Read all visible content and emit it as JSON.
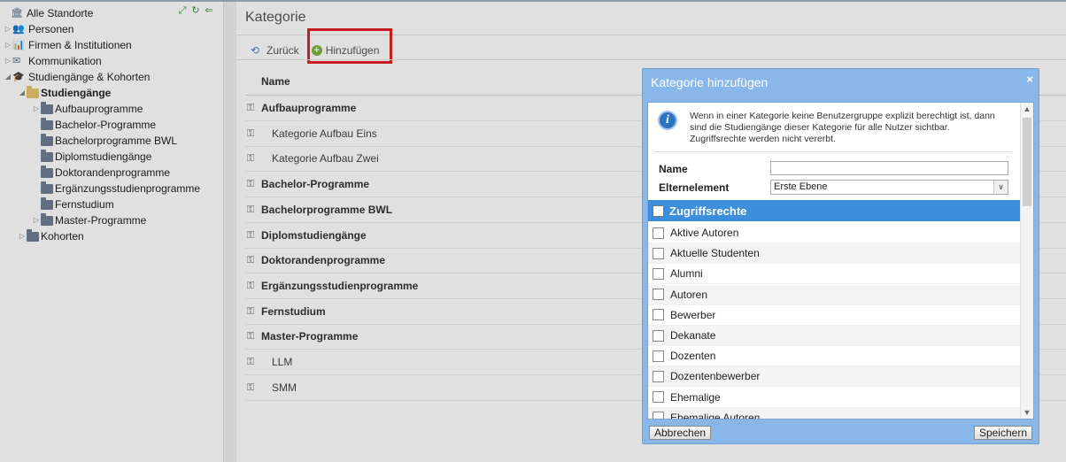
{
  "sidebar": {
    "items": [
      {
        "label": "Alle Standorte",
        "icon": "building-icon",
        "bold": false
      },
      {
        "label": "Personen",
        "icon": "people-icon",
        "bold": false
      },
      {
        "label": "Firmen & Institutionen",
        "icon": "chart-icon",
        "bold": false
      },
      {
        "label": "Kommunikation",
        "icon": "mail-icon",
        "bold": false
      },
      {
        "label": "Studiengänge & Kohorten",
        "icon": "grad-cap-icon",
        "bold": false
      },
      {
        "label": "Studiengänge",
        "icon": "folder-open-icon",
        "bold": true
      },
      {
        "label": "Aufbauprogramme",
        "icon": "folder-icon",
        "bold": false
      },
      {
        "label": "Bachelor-Programme",
        "icon": "folder-icon",
        "bold": false
      },
      {
        "label": "Bachelorprogramme BWL",
        "icon": "folder-icon",
        "bold": false
      },
      {
        "label": "Diplomstudiengänge",
        "icon": "folder-icon",
        "bold": false
      },
      {
        "label": "Doktorandenprogramme",
        "icon": "folder-icon",
        "bold": false
      },
      {
        "label": "Ergänzungsstudienprogramme",
        "icon": "folder-icon",
        "bold": false
      },
      {
        "label": "Fernstudium",
        "icon": "folder-icon",
        "bold": false
      },
      {
        "label": "Master-Programme",
        "icon": "folder-icon",
        "bold": false
      },
      {
        "label": "Kohorten",
        "icon": "folder-icon",
        "bold": false
      }
    ]
  },
  "main": {
    "title": "Kategorie",
    "toolbar": {
      "back_label": "Zurück",
      "add_label": "Hinzufügen"
    },
    "column_header": "Name",
    "rows": [
      {
        "label": "Aufbauprogramme",
        "type": "parent"
      },
      {
        "label": "Kategorie Aufbau Eins",
        "type": "child"
      },
      {
        "label": "Kategorie Aufbau Zwei",
        "type": "child"
      },
      {
        "label": "Bachelor-Programme",
        "type": "parent"
      },
      {
        "label": "Bachelorprogramme BWL",
        "type": "parent"
      },
      {
        "label": "Diplomstudiengänge",
        "type": "parent"
      },
      {
        "label": "Doktorandenprogramme",
        "type": "parent"
      },
      {
        "label": "Ergänzungsstudienprogramme",
        "type": "parent"
      },
      {
        "label": "Fernstudium",
        "type": "parent"
      },
      {
        "label": "Master-Programme",
        "type": "parent"
      },
      {
        "label": "LLM",
        "type": "child"
      },
      {
        "label": "SMM",
        "type": "child"
      }
    ]
  },
  "dialog": {
    "title": "Kategorie hinzufügen",
    "close": "×",
    "info_text": "Wenn in einer Kategorie keine Benutzergruppe explizit berechtigt ist, dann sind die Studiengänge dieser Kategorie für alle Nutzer sichtbar. Zugriffsrechte werden nicht vererbt.",
    "name_label": "Name",
    "name_value": "",
    "parent_label": "Elternelement",
    "parent_value": "Erste Ebene",
    "permissions_header": "Zugriffsrechte",
    "permissions": [
      "Aktive Autoren",
      "Aktuelle Studenten",
      "Alumni",
      "Autoren",
      "Bewerber",
      "Dekanate",
      "Dozenten",
      "Dozentenbewerber",
      "Ehemalige",
      "Ehemalige Autoren"
    ],
    "cancel_label": "Abbrechen",
    "save_label": "Speichern"
  },
  "colors": {
    "dialog_bg": "#8ab7e9",
    "perm_header": "#3d8fdb",
    "highlight": "#e32020"
  }
}
